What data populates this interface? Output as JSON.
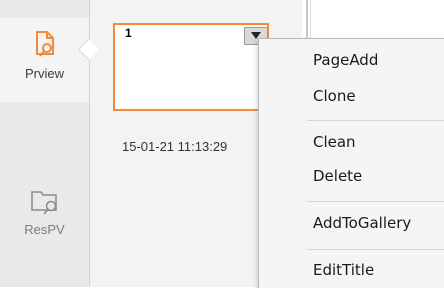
{
  "sidebar": {
    "tabs": [
      {
        "label": "Prview",
        "icon": "document-search-icon",
        "active": true
      },
      {
        "label": "ResPV",
        "icon": "folder-search-icon",
        "active": false
      }
    ]
  },
  "panel": {
    "thumbnail": {
      "number": "1",
      "dropdown_icon": "dropdown-triangle-icon"
    },
    "timestamp": "15-01-21 11:13:29"
  },
  "context_menu": {
    "groups": [
      [
        "PageAdd",
        "Clone"
      ],
      [
        "Clean",
        "Delete"
      ],
      [
        "AddToGallery"
      ],
      [
        "EditTitle"
      ]
    ]
  },
  "colors": {
    "accent": "#f08a3c",
    "sidebar_bg": "#e9e9e9",
    "menu_bg": "#f5f5f5"
  }
}
